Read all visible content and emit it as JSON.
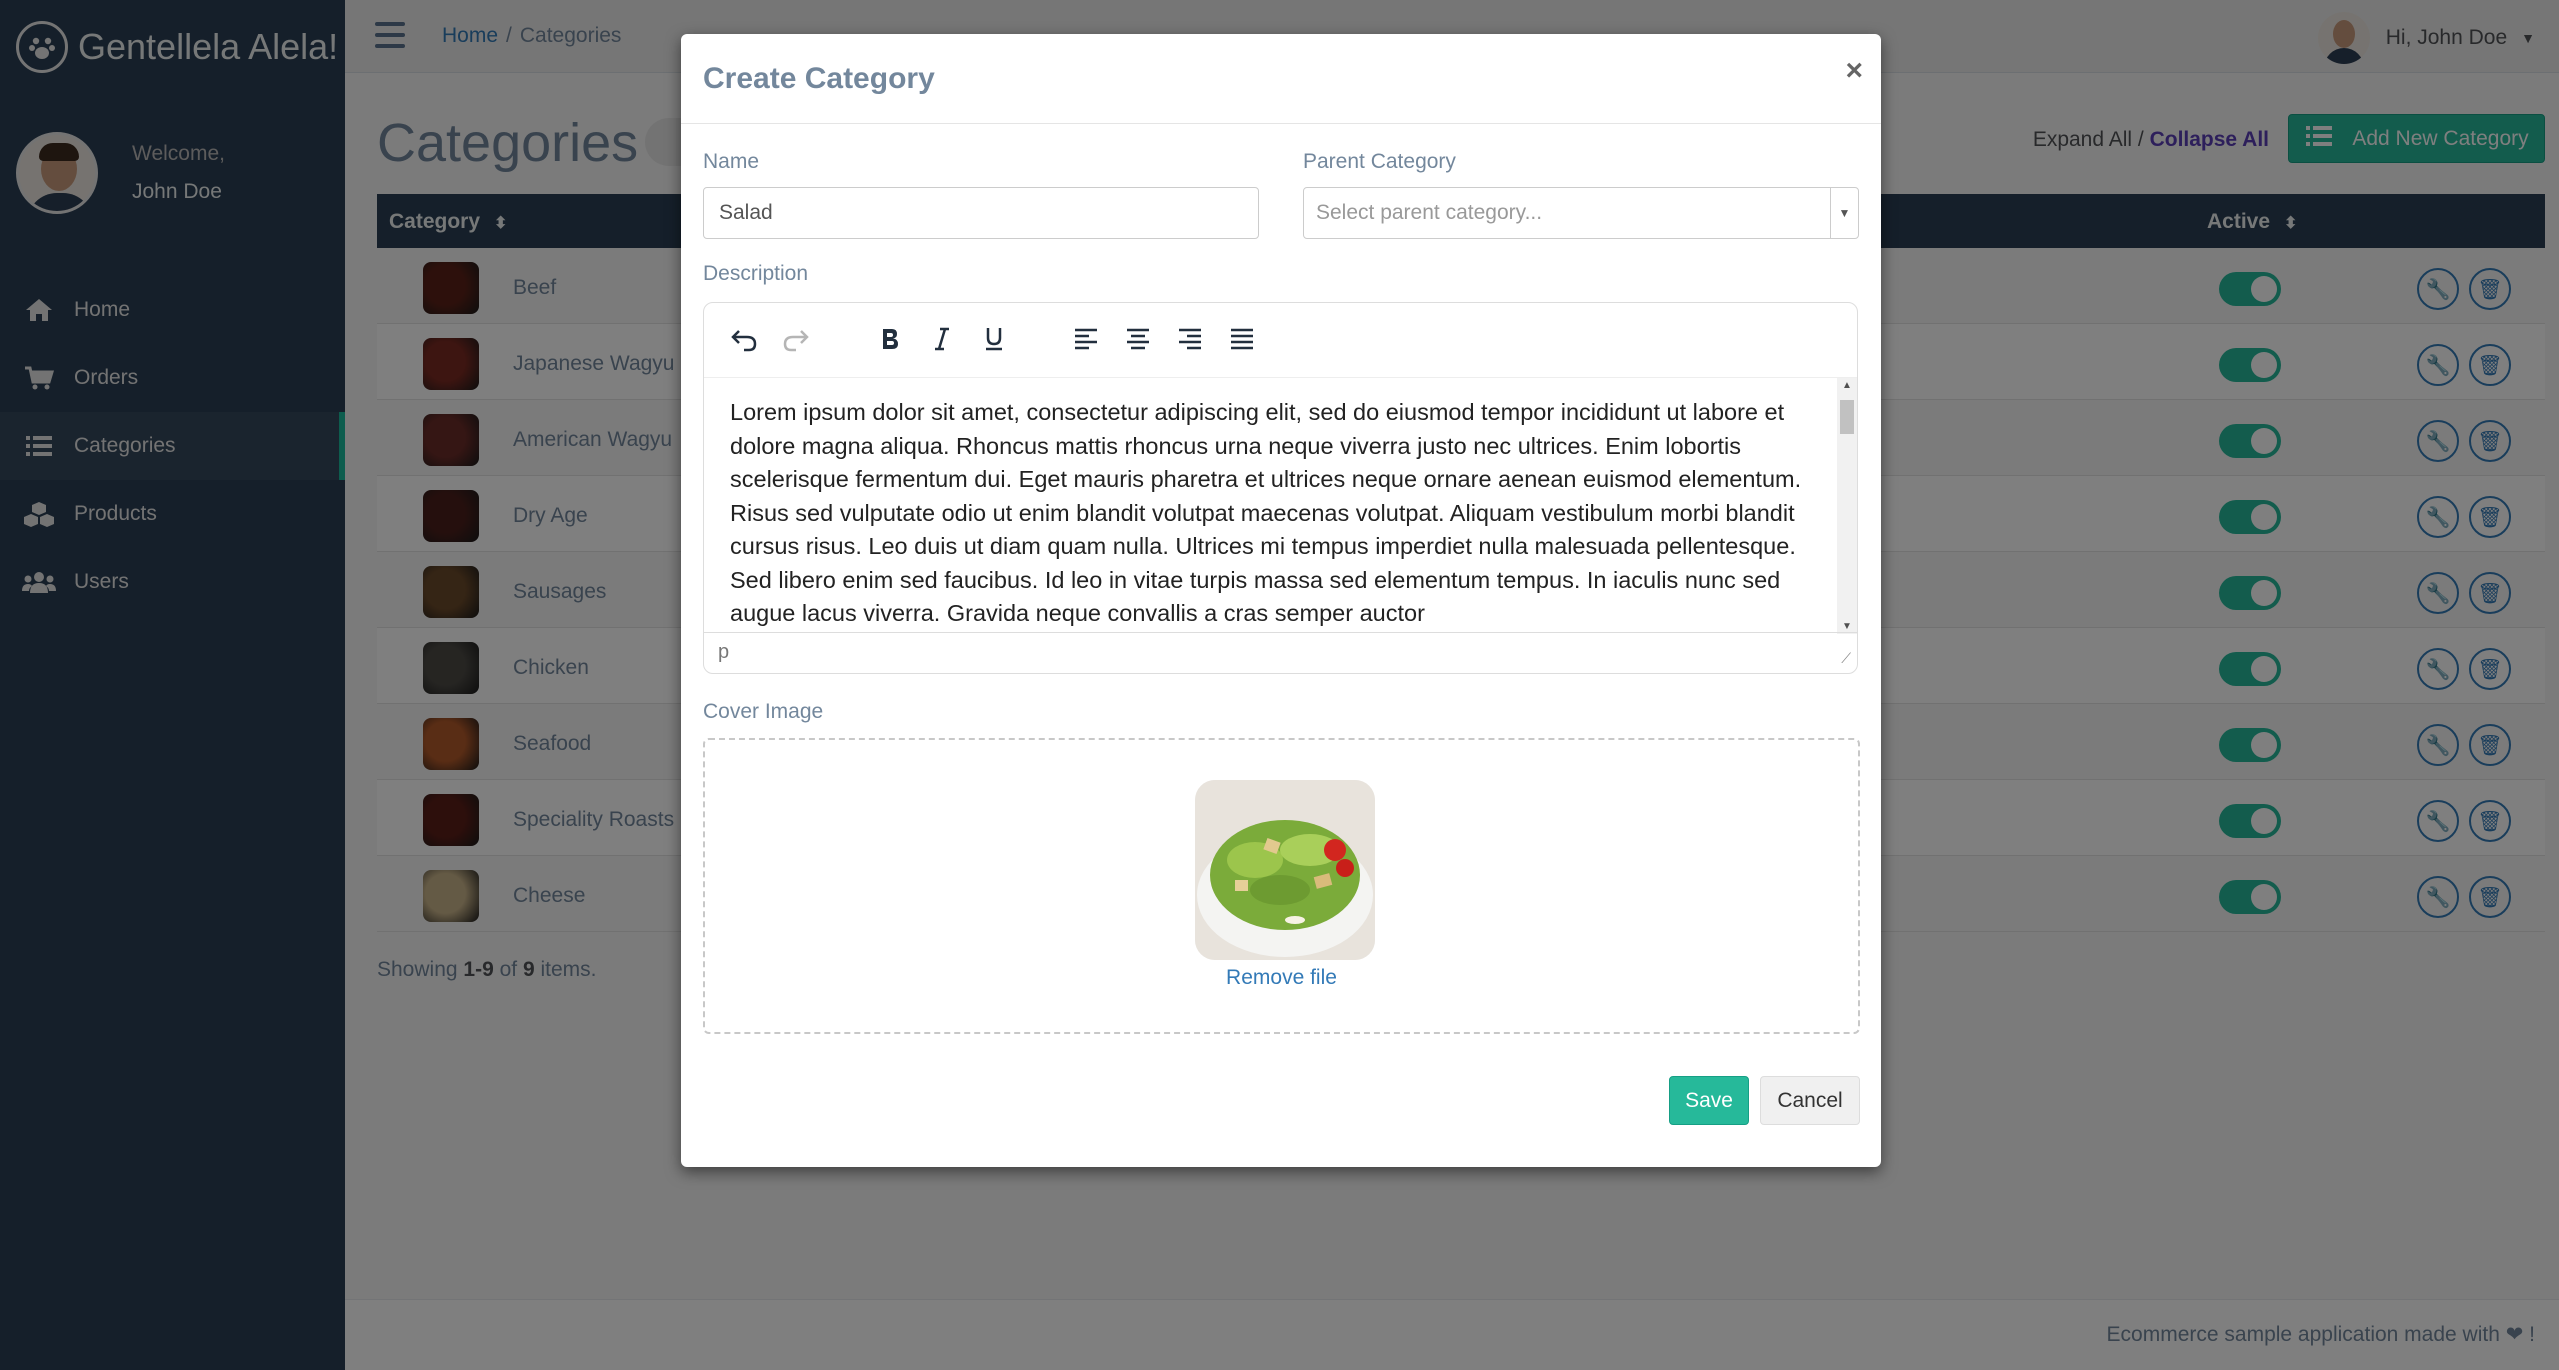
{
  "brand": {
    "title": "Gentellela Alela!"
  },
  "profile": {
    "welcome": "Welcome,",
    "name": "John Doe"
  },
  "nav": [
    {
      "label": "Home",
      "icon": "home-icon"
    },
    {
      "label": "Orders",
      "icon": "cart-icon"
    },
    {
      "label": "Categories",
      "icon": "list-icon",
      "active": true
    },
    {
      "label": "Products",
      "icon": "cubes-icon"
    },
    {
      "label": "Users",
      "icon": "users-icon"
    }
  ],
  "topbar": {
    "breadcrumb": {
      "home": "Home",
      "sep": "/",
      "current": "Categories"
    },
    "greeting": "Hi, John Doe"
  },
  "page": {
    "title": "Categories",
    "expand_all": "Expand All",
    "links_sep": " / ",
    "collapse_all": "Collapse All",
    "add_button": "Add New Category"
  },
  "table": {
    "headers": {
      "category": "Category",
      "active": "Active"
    },
    "rows": [
      {
        "name": "Beef",
        "active": true,
        "thumb_color": "#5a2118"
      },
      {
        "name": "Japanese Wagyu",
        "active": true,
        "thumb_color": "#7a2a22"
      },
      {
        "name": "American Wagyu",
        "active": true,
        "thumb_color": "#6a2c28"
      },
      {
        "name": "Dry Age",
        "active": true,
        "thumb_color": "#4a1f1a"
      },
      {
        "name": "Sausages",
        "active": true,
        "thumb_color": "#6b4a2a"
      },
      {
        "name": "Chicken",
        "active": true,
        "thumb_color": "#4c4a45"
      },
      {
        "name": "Seafood",
        "active": true,
        "thumb_color": "#b35a2a"
      },
      {
        "name": "Speciality Roasts",
        "active": true,
        "thumb_color": "#5a1e18"
      },
      {
        "name": "Cheese",
        "active": true,
        "thumb_color": "#c9b48a"
      }
    ],
    "summary": {
      "prefix": "Showing ",
      "range": "1-9",
      "of": " of ",
      "total": "9",
      "suffix": " items."
    }
  },
  "footer": {
    "text": "Ecommerce sample application made with ❤ !"
  },
  "modal": {
    "title": "Create Category",
    "close": "×",
    "name_label": "Name",
    "name_value": "Salad",
    "parent_label": "Parent Category",
    "parent_placeholder": "Select parent category...",
    "description_label": "Description",
    "description_text": "Lorem ipsum dolor sit amet, consectetur adipiscing elit, sed do eiusmod tempor incididunt ut labore et dolore magna aliqua. Rhoncus mattis rhoncus urna neque viverra justo nec ultrices. Enim lobortis scelerisque fermentum dui. Eget mauris pharetra et ultrices neque ornare aenean euismod elementum. Risus sed vulputate odio ut enim blandit volutpat maecenas volutpat. Aliquam vestibulum morbi blandit cursus risus. Leo duis ut diam quam nulla. Ultrices mi tempus imperdiet nulla malesuada pellentesque. Sed libero enim sed faucibus. Id leo in vitae turpis massa sed elementum tempus. In iaculis nunc sed augue lacus viverra. Gravida neque convallis a cras semper auctor",
    "editor_status": "p",
    "cover_label": "Cover Image",
    "remove_file": "Remove file",
    "save": "Save",
    "cancel": "Cancel"
  },
  "colors": {
    "sidebar": "#2a3f54",
    "accent": "#26b99a",
    "link": "#337ab7",
    "text": "#73879c"
  }
}
